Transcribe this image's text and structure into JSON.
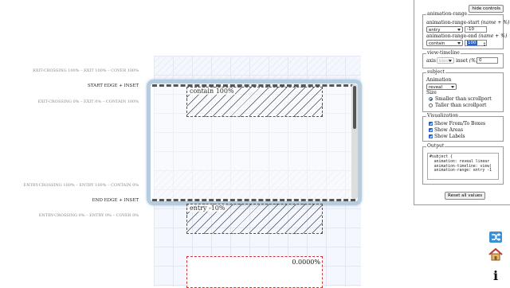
{
  "track_labels": {
    "exit_crossing_cover": "EXIT-CROSSING 100% – EXIT 100% – COVER 100%",
    "start_edge": "START EDGE + INSET",
    "exit_crossing_contain": "EXIT-CROSSING 0% – EXIT 0% – CONTAIN 100%",
    "entry_crossing_contain": "ENTRY-CROSSING 100% – ENTRY 100% – CONTAIN 0%",
    "end_edge": "END EDGE + INSET",
    "entry_crossing_cover": "ENTRY-CROSSING 0% – ENTRY 0% – COVER 0%"
  },
  "visual": {
    "subject_top_label": "contain 100%",
    "subject_bottom_label": "entry -10%",
    "progress_value": "0.0000%"
  },
  "controls": {
    "hide_button": "hide controls",
    "animation_range": {
      "legend": "animation-range",
      "start_label": "animation-range-start",
      "start_hint": "(name + %)",
      "start_name": "entry",
      "start_percent": "-10",
      "end_label": "animation-range-end",
      "end_hint": "(name + %)",
      "end_name": "contain",
      "end_percent": "100"
    },
    "view_timeline": {
      "legend": "view-timeline",
      "axis_label": "axis",
      "axis_value": "block",
      "inset_label": "inset",
      "inset_unit": "(%)",
      "inset_value": "0"
    },
    "subject": {
      "legend": "subject",
      "animation_label": "Animation",
      "animation_value": "reveal",
      "size_label": "Size",
      "size_options": [
        "Smaller than scrollport",
        "Taller than scrollport"
      ],
      "size_selected": 0
    },
    "visualization": {
      "legend": "Visualization",
      "options": [
        "Show From/To Boxes",
        "Show Areas",
        "Show Labels"
      ]
    },
    "output": {
      "legend": "Output",
      "code": "#subject {\n  animation: reveal linear\n  animation-timeline: view(\n  animation-range: entry -1"
    },
    "reset_button": "Reset all values"
  },
  "widgets": {
    "shuffle_icon": "shuffle-icon",
    "home_icon": "home-icon",
    "info_icon": "info-icon",
    "info_glyph": "i"
  },
  "colors": {
    "scroller_border": "#b6cde0",
    "progress_border": "#cc3333",
    "accent": "#1a5fd0"
  }
}
